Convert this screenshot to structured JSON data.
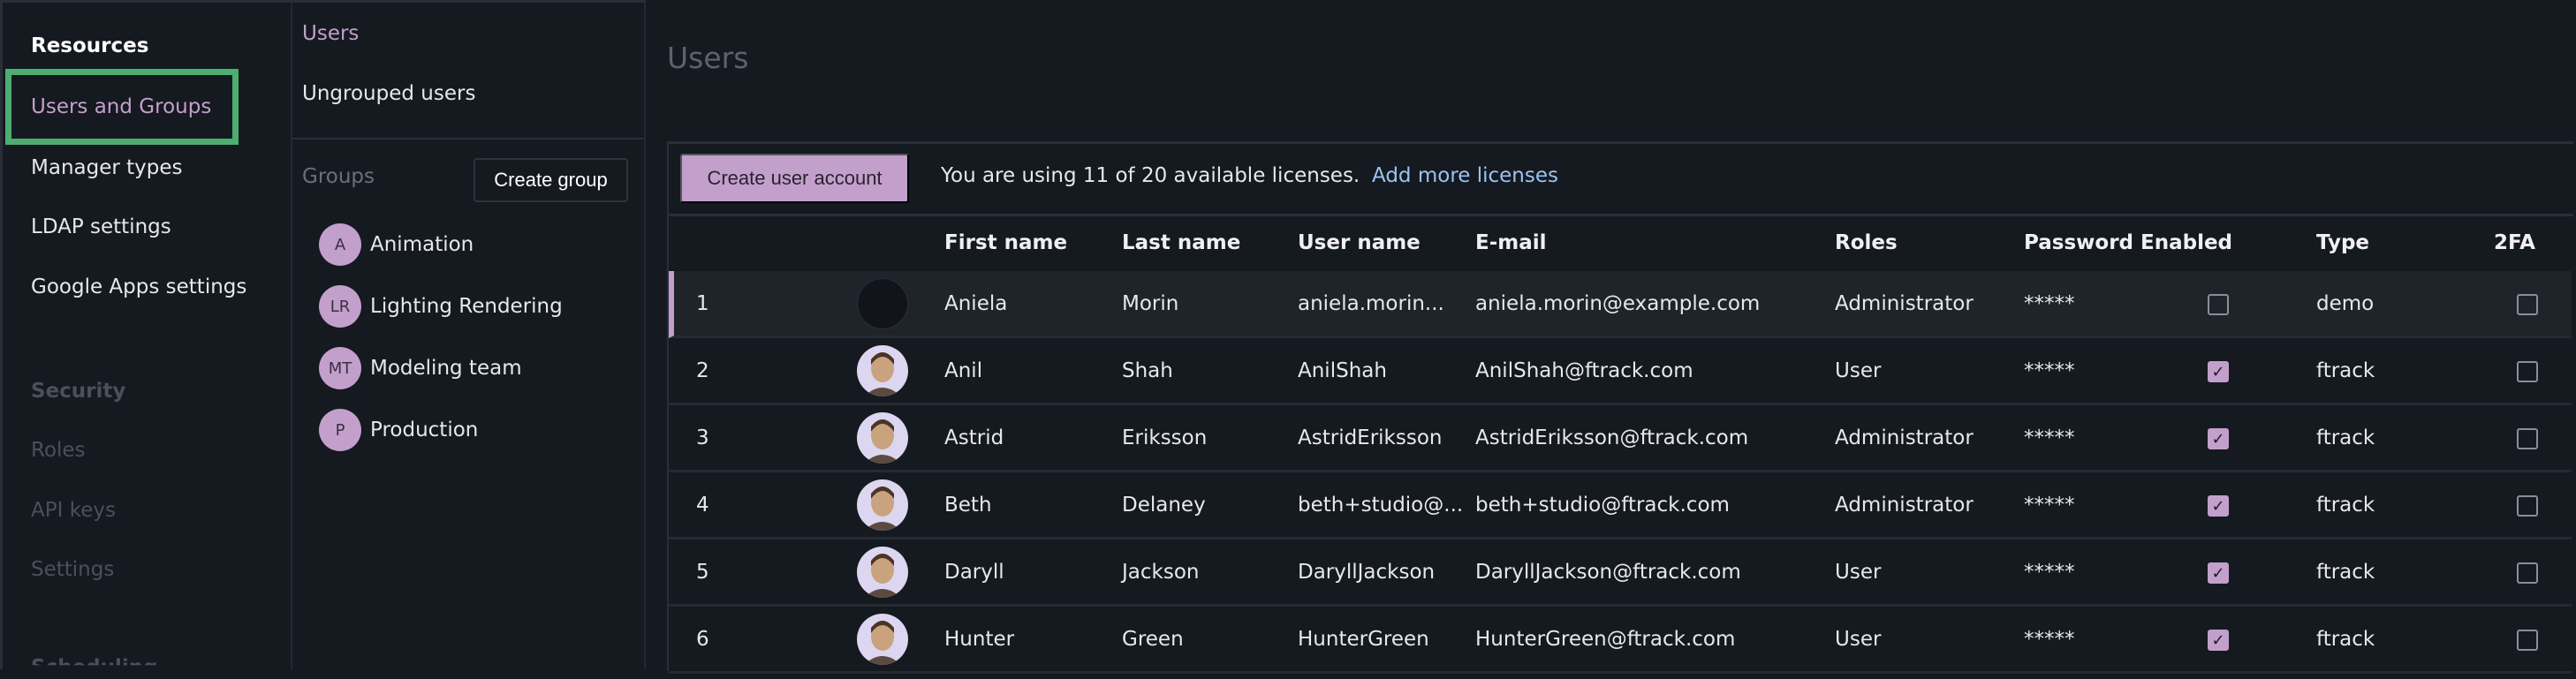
{
  "sidebar": {
    "resources_heading": "Resources",
    "items": [
      "Users and Groups",
      "Manager types",
      "LDAP settings",
      "Google Apps settings"
    ],
    "security_heading": "Security",
    "security_items": [
      "Roles",
      "API keys",
      "Settings"
    ],
    "next_heading_partial": "Scheduling"
  },
  "groups_panel": {
    "users_link": "Users",
    "ungrouped": "Ungrouped users",
    "groups_label": "Groups",
    "create_group": "Create group",
    "groups": [
      {
        "initials": "A",
        "name": "Animation"
      },
      {
        "initials": "LR",
        "name": "Lighting Rendering"
      },
      {
        "initials": "MT",
        "name": "Modeling team"
      },
      {
        "initials": "P",
        "name": "Production"
      }
    ]
  },
  "main": {
    "title": "Users",
    "create_user": "Create user account",
    "license_text": "You are using 11 of 20 available licenses.",
    "add_licenses": "Add more licenses",
    "columns": [
      "First name",
      "Last name",
      "User name",
      "E-mail",
      "Roles",
      "Password",
      "Enabled",
      "Type",
      "2FA"
    ],
    "rows": [
      {
        "n": "1",
        "first": "Aniela",
        "last": "Morin",
        "user": "aniela.morin...",
        "email": "aniela.morin@example.com",
        "role": "Administrator",
        "password": "*****",
        "enabled": false,
        "type": "demo",
        "twofa": false,
        "avatar": "empty",
        "selected": true
      },
      {
        "n": "2",
        "first": "Anil",
        "last": "Shah",
        "user": "AnilShah",
        "email": "AnilShah@ftrack.com",
        "role": "User",
        "password": "*****",
        "enabled": true,
        "type": "ftrack",
        "twofa": false,
        "avatar": "photo"
      },
      {
        "n": "3",
        "first": "Astrid",
        "last": "Eriksson",
        "user": "AstridEriksson",
        "email": "AstridEriksson@ftrack.com",
        "role": "Administrator",
        "password": "*****",
        "enabled": true,
        "type": "ftrack",
        "twofa": false,
        "avatar": "photo"
      },
      {
        "n": "4",
        "first": "Beth",
        "last": "Delaney",
        "user": "beth+studio@...",
        "email": "beth+studio@ftrack.com",
        "role": "Administrator",
        "password": "*****",
        "enabled": true,
        "type": "ftrack",
        "twofa": false,
        "avatar": "photo"
      },
      {
        "n": "5",
        "first": "Daryll",
        "last": "Jackson",
        "user": "DaryllJackson",
        "email": "DaryllJackson@ftrack.com",
        "role": "User",
        "password": "*****",
        "enabled": true,
        "type": "ftrack",
        "twofa": false,
        "avatar": "photo"
      },
      {
        "n": "6",
        "first": "Hunter",
        "last": "Green",
        "user": "HunterGreen",
        "email": "HunterGreen@ftrack.com",
        "role": "User",
        "password": "*****",
        "enabled": true,
        "type": "ftrack",
        "twofa": false,
        "avatar": "photo"
      }
    ]
  },
  "colors": {
    "accent": "#c39fcc",
    "link": "#9bc3f0",
    "highlight_box": "#4cae71",
    "background": "#151920"
  }
}
